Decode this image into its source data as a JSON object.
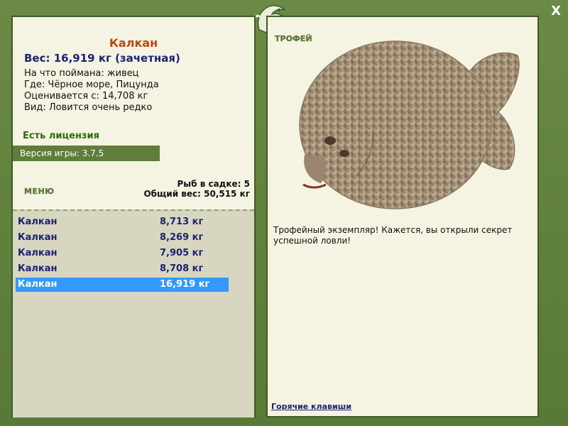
{
  "header": {
    "close_label": "X"
  },
  "fish": {
    "name": "Калкан",
    "weight_line": "Вес: 16,919 кг (зачетная)",
    "caught_on": "На что поймана: живец",
    "location": "Где: Чёрное море, Пицунда",
    "valued_from": "Оценивается с: 14,708 кг",
    "rarity": "Вид: Ловится очень редко"
  },
  "license": "Есть лицензия",
  "version": "Версия игры: 3.7.5",
  "menu_label": "МЕНЮ",
  "keepnet": {
    "count_line": "Рыб в садке: 5",
    "total_line": "Общий вес: 50,515 кг"
  },
  "catches": [
    {
      "name": "Калкан",
      "weight": "8,713 кг"
    },
    {
      "name": "Калкан",
      "weight": "8,269 кг"
    },
    {
      "name": "Калкан",
      "weight": "7,905 кг"
    },
    {
      "name": "Калкан",
      "weight": "8,708 кг"
    },
    {
      "name": "Калкан",
      "weight": "16,919 кг"
    }
  ],
  "selected_index": 4,
  "trophy": {
    "label": "ТРОФЕЙ",
    "description": "Трофейный экземпляр! Кажется, вы открыли секрет успешной ловли!"
  },
  "hotkeys_label": "Горячие клавиши",
  "colors": {
    "accent": "#5f7d3b",
    "selection": "#3399ff",
    "title": "#b84a10",
    "value_text": "#1a2370"
  }
}
